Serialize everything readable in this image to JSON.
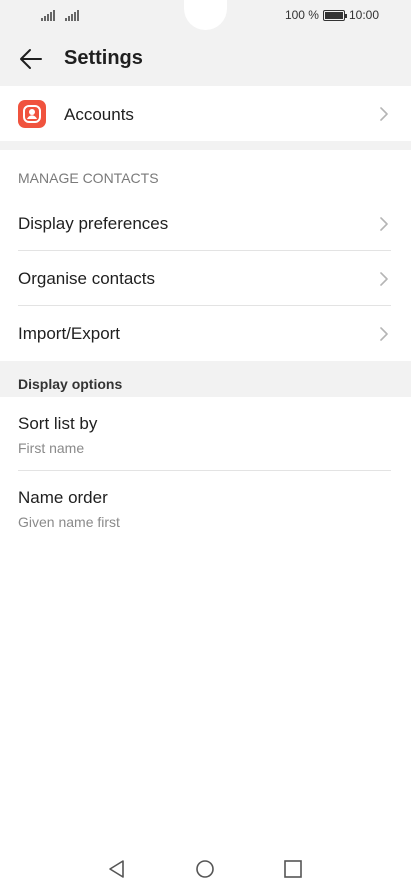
{
  "status_bar": {
    "battery_text": "100 %",
    "time": "10:00"
  },
  "header": {
    "title": "Settings",
    "back_icon": "arrow-left-icon"
  },
  "accounts": {
    "label": "Accounts",
    "icon": "contacts-app-icon",
    "icon_color": "#f0533e"
  },
  "manage_contacts": {
    "heading": "MANAGE CONTACTS",
    "items": [
      {
        "label": "Display preferences"
      },
      {
        "label": "Organise contacts"
      },
      {
        "label": "Import/Export"
      }
    ]
  },
  "display_options": {
    "heading": "Display options",
    "items": [
      {
        "label": "Sort list by",
        "value": "First name"
      },
      {
        "label": "Name order",
        "value": "Given name first"
      }
    ]
  },
  "nav": {
    "back": "triangle-back-icon",
    "home": "circle-home-icon",
    "recents": "square-recents-icon"
  }
}
